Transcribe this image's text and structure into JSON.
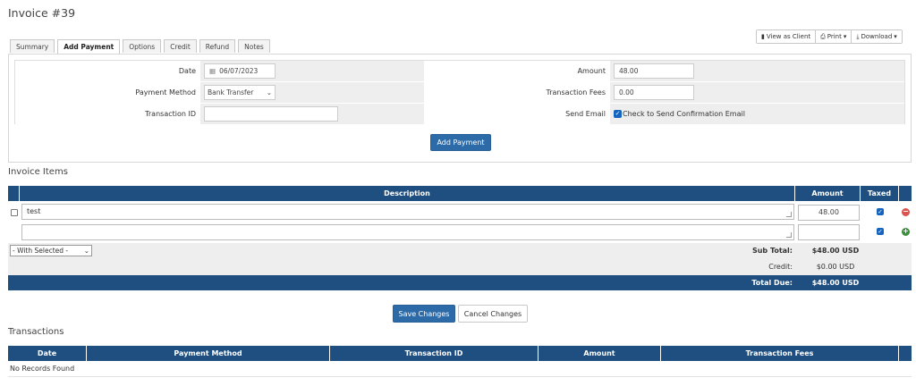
{
  "page": {
    "title": "Invoice #39"
  },
  "actions": {
    "view_as_client": "View as Client",
    "print": "Print",
    "download": "Download"
  },
  "tabs": [
    "Summary",
    "Add Payment",
    "Options",
    "Credit",
    "Refund",
    "Notes"
  ],
  "payment_form": {
    "date_label": "Date",
    "date_value": "06/07/2023",
    "amount_label": "Amount",
    "amount_value": "48.00",
    "method_label": "Payment Method",
    "method_value": "Bank Transfer",
    "fees_label": "Transaction Fees",
    "fees_value": "0.00",
    "txid_label": "Transaction ID",
    "txid_value": "",
    "send_email_label": "Send Email",
    "send_email_check": "Check to Send Confirmation Email",
    "submit": "Add Payment"
  },
  "invoice_items": {
    "heading": "Invoice Items",
    "columns": [
      "Description",
      "Amount",
      "Taxed"
    ],
    "rows": [
      {
        "description": "test",
        "amount": "48.00",
        "taxed": true
      },
      {
        "description": "",
        "amount": "",
        "taxed": true
      }
    ],
    "with_selected": "- With Selected -",
    "subtotal_label": "Sub Total:",
    "subtotal_value": "$48.00 USD",
    "credit_label": "Credit:",
    "credit_value": "$0.00 USD",
    "total_label": "Total Due:",
    "total_value": "$48.00 USD",
    "save": "Save Changes",
    "cancel": "Cancel Changes"
  },
  "transactions": {
    "heading": "Transactions",
    "columns": [
      "Date",
      "Payment Method",
      "Transaction ID",
      "Amount",
      "Transaction Fees"
    ],
    "empty": "No Records Found"
  },
  "colors": {
    "header": "#1e4f80",
    "primary": "#2c6aa8",
    "remove": "#d9534f",
    "add": "#3a8f3a"
  }
}
